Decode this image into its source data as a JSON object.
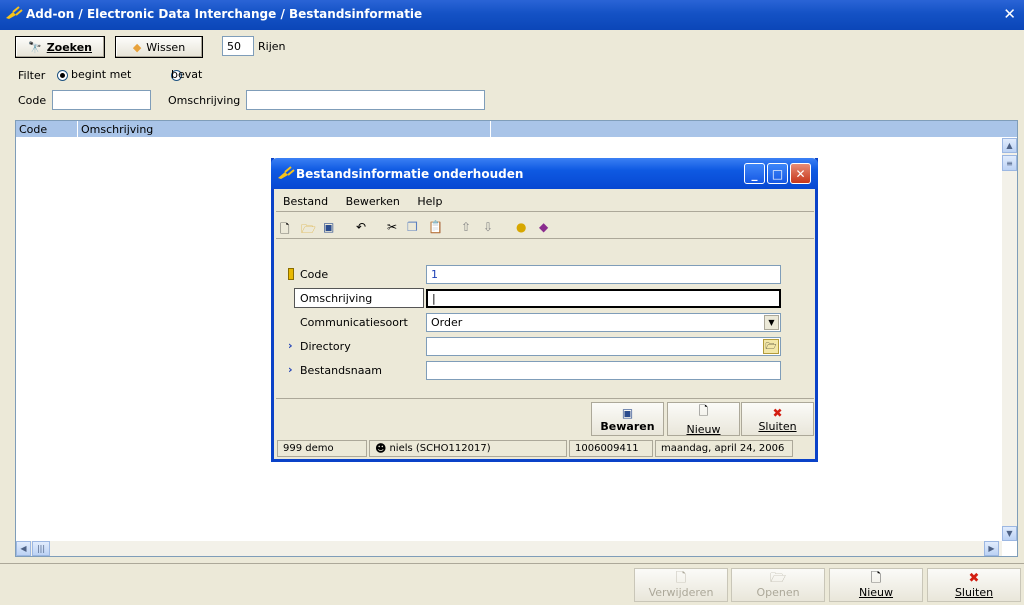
{
  "window": {
    "title": "Add-on / Electronic Data Interchange / Bestandsinformatie",
    "close_icon": "close-icon"
  },
  "toolbar": {
    "search_label": "Zoeken",
    "clear_label": "Wissen",
    "rows_value": "50",
    "rows_label": "Rijen"
  },
  "filter": {
    "label": "Filter",
    "option_begins": "begint met",
    "option_contains": "bevat",
    "selected": "begint met",
    "code_label": "Code",
    "code_value": "",
    "description_label": "Omschrijving",
    "description_value": ""
  },
  "grid": {
    "columns": [
      "Code",
      "Omschrijving"
    ],
    "rows": []
  },
  "bottom": {
    "delete_label": "Verwijderen",
    "open_label": "Openen",
    "new_label": "Nieuw",
    "close_label": "Sluiten"
  },
  "dialog": {
    "title": "Bestandsinformatie onderhouden",
    "menu": [
      "Bestand",
      "Bewerken",
      "Help"
    ],
    "fields": {
      "code_label": "Code",
      "code_value": "1",
      "description_label": "Omschrijving",
      "description_value": "",
      "comm_label": "Communicatiesoort",
      "comm_value": "Order",
      "directory_label": "Directory",
      "directory_value": "",
      "filename_label": "Bestandsnaam",
      "filename_value": ""
    },
    "buttons": {
      "save": "Bewaren",
      "new": "Nieuw",
      "close": "Sluiten"
    },
    "status": {
      "company": "999 demo",
      "user": "niels (SCHO112017)",
      "number": "1006009411",
      "date": "maandag, april 24, 2006"
    }
  },
  "colors": {
    "title_bar": "#1452c5",
    "grid_header": "#a9c4e8",
    "close_red": "#c7361b"
  }
}
